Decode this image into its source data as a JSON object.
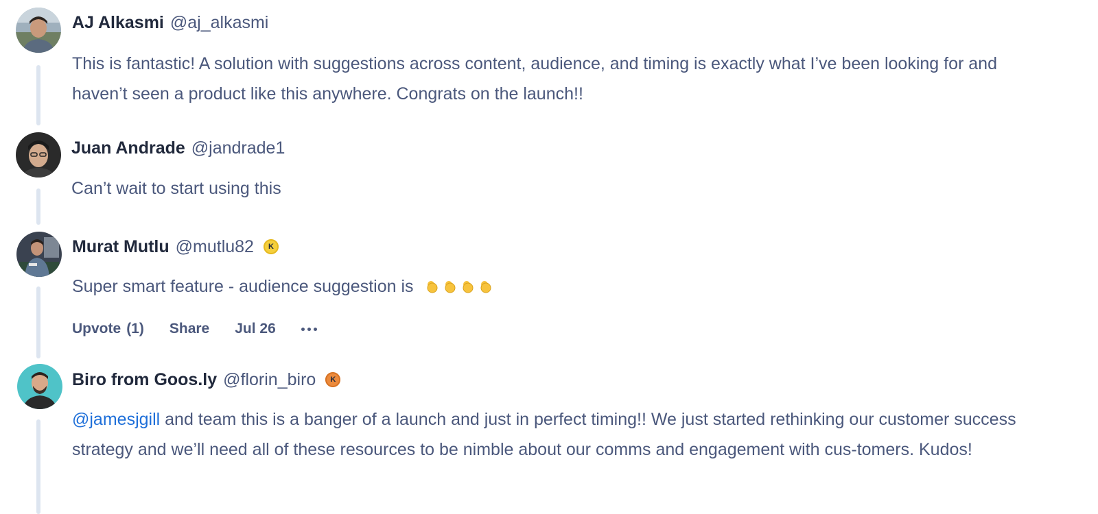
{
  "comments": [
    {
      "name": "AJ Alkasmi",
      "handle": "@aj_alkasmi",
      "body": "This is fantastic! A solution with suggestions across content, audience, and timing is exactly what I’ve been looking for and haven’t seen a product like this anywhere. Congrats on the launch!!"
    },
    {
      "name": "Juan Andrade",
      "handle": "@jandrade1",
      "body": "Can’t wait to start using this"
    },
    {
      "name": "Murat Mutlu",
      "handle": "@mutlu82",
      "badge": "K",
      "body": "Super smart feature - audience suggestion is",
      "emoji": "ok-hand-emoji",
      "actions": {
        "upvote_label": "Upvote",
        "upvote_count": "(1)",
        "share_label": "Share",
        "date": "Jul 26"
      }
    },
    {
      "name": "Biro from Goos.ly",
      "handle": "@florin_biro",
      "badge": "K",
      "mention": "@jamesjgill",
      "body": " and team this is a banger of a launch and just in perfect timing!! We just started rethinking our customer success strategy and we’ll need all of these resources to be nimble about our comms and engagement with cus-tomers. Kudos!"
    }
  ],
  "colors": {
    "name": "#21293c",
    "text": "#4b587c",
    "mention": "#1e6fd9",
    "thread_line": "#dde5f0",
    "badge_gold": "#f5cf3c",
    "badge_orange": "#ec8a3c"
  }
}
